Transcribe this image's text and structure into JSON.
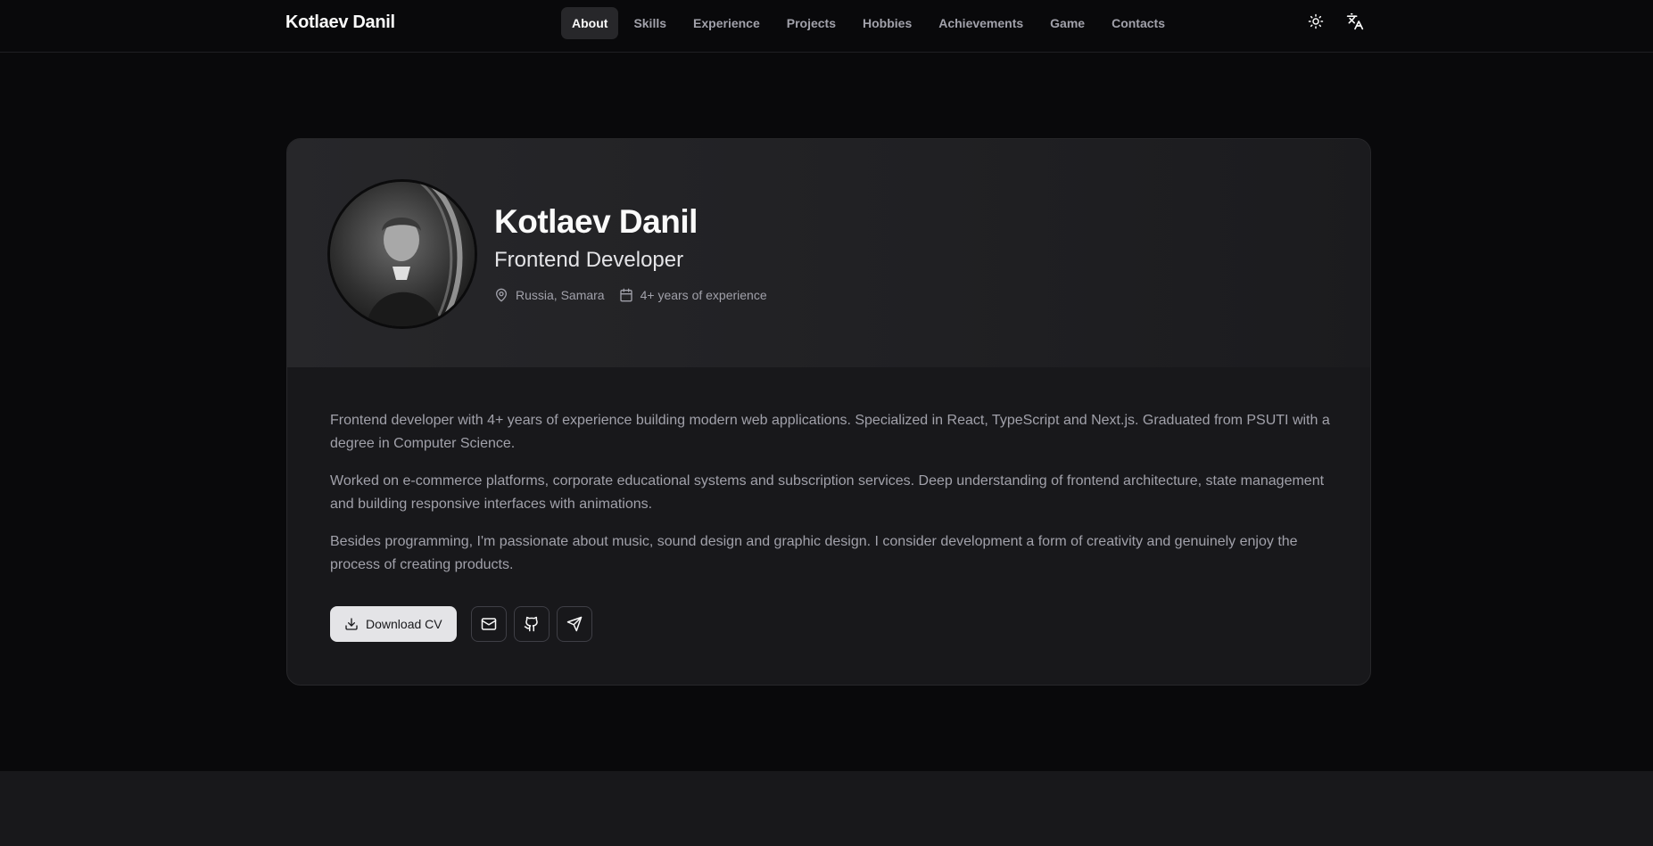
{
  "header": {
    "brand": "Kotlaev Danil",
    "nav": [
      {
        "label": "About",
        "active": true
      },
      {
        "label": "Skills"
      },
      {
        "label": "Experience"
      },
      {
        "label": "Projects"
      },
      {
        "label": "Hobbies"
      },
      {
        "label": "Achievements"
      },
      {
        "label": "Game"
      },
      {
        "label": "Contacts"
      }
    ],
    "icons": [
      "sun-icon",
      "translate-icon"
    ]
  },
  "profile": {
    "name": "Kotlaev Danil",
    "role": "Frontend Developer",
    "location": "Russia, Samara",
    "experience": "4+ years of experience"
  },
  "bio": [
    "Frontend developer with 4+ years of experience building modern web applications. Specialized in React, TypeScript and Next.js. Graduated from PSUTI with a degree in Computer Science.",
    "Worked on e-commerce platforms, corporate educational systems and subscription services. Deep understanding of frontend architecture, state management and building responsive interfaces with animations.",
    "Besides programming, I'm passionate about music, sound design and graphic design. I consider development a form of creativity and genuinely enjoy the process of creating products."
  ],
  "actions": {
    "download_cv": "Download CV",
    "icons": [
      "mail-icon",
      "github-icon",
      "telegram-icon"
    ]
  }
}
